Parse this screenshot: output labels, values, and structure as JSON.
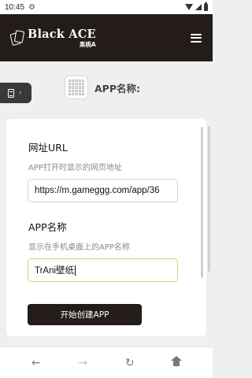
{
  "status_bar": {
    "time": "10:45",
    "left_icon": "gear-icon",
    "right_icons": [
      "wifi-icon",
      "signal-icon",
      "battery-icon"
    ]
  },
  "header": {
    "brand_name": "Black ACE",
    "brand_sub": "黑桃A",
    "menu_icon": "hamburger-menu-icon",
    "background": "#241c19"
  },
  "side_tab": {
    "icons": [
      "document-icon",
      "chevron-right-icon"
    ],
    "chevron": "›"
  },
  "app_heading": {
    "icon": "app-icon-placeholder",
    "label": "APP名称:"
  },
  "form": {
    "url_title": "网址URL",
    "url_hint": "APP打开时显示的网页地址",
    "url_value": "https://m.gameggg.com/app/36",
    "name_title": "APP名称",
    "name_hint": "显示在手机桌面上的APP名称",
    "name_value": "TrAni壁纸",
    "submit_label": "开始创建APP"
  },
  "bottom_nav": {
    "back": "←",
    "forward": "→",
    "reload": "↻",
    "home": "home-icon"
  },
  "colors": {
    "accent_dark": "#241c19",
    "focus_border": "#e2c77d",
    "page_bg": "#f0efef"
  }
}
